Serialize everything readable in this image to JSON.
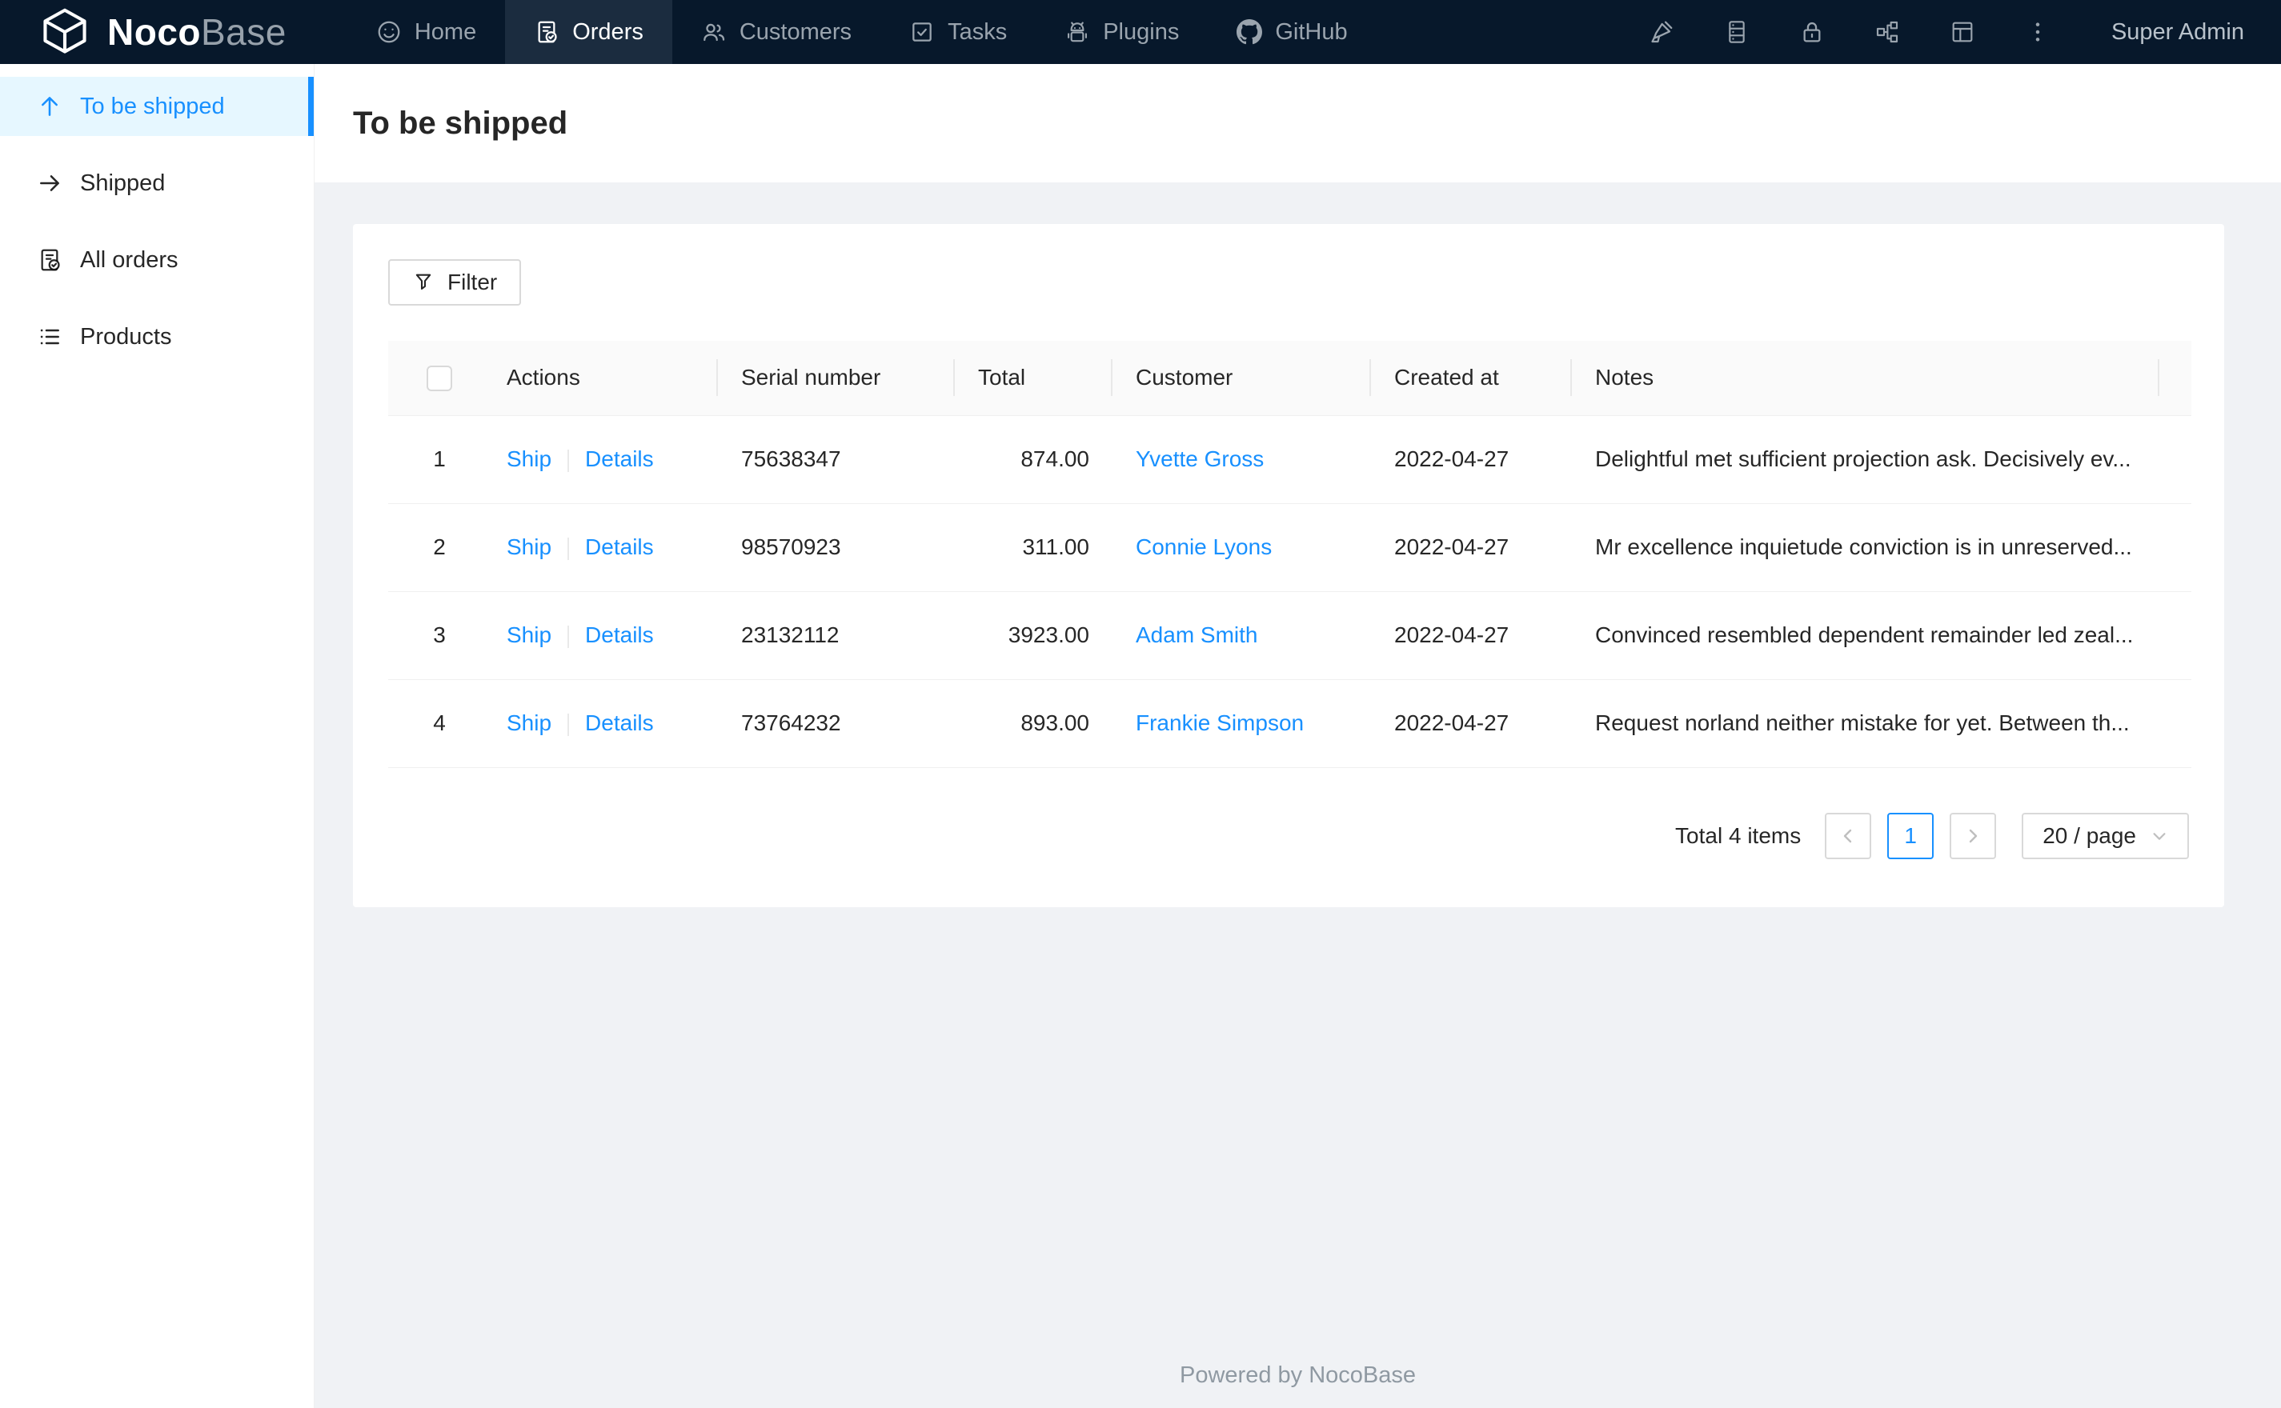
{
  "navbar": {
    "brand_bold": "Noco",
    "brand_light": "Base",
    "items": [
      {
        "label": "Home",
        "icon": "smiley-icon",
        "active": false
      },
      {
        "label": "Orders",
        "icon": "file-done-icon",
        "active": true
      },
      {
        "label": "Customers",
        "icon": "team-icon",
        "active": false
      },
      {
        "label": "Tasks",
        "icon": "check-square-icon",
        "active": false
      },
      {
        "label": "Plugins",
        "icon": "robot-icon",
        "active": false
      },
      {
        "label": "GitHub",
        "icon": "github-icon",
        "active": false
      }
    ],
    "tools": [
      "highlighter-icon",
      "collections-icon",
      "lock-icon",
      "api-icon",
      "layout-icon",
      "ellipsis-icon"
    ],
    "user": "Super Admin"
  },
  "sidebar": {
    "items": [
      {
        "label": "To be shipped",
        "icon": "arrow-up-icon",
        "active": true
      },
      {
        "label": "Shipped",
        "icon": "arrow-right-icon",
        "active": false
      },
      {
        "label": "All orders",
        "icon": "file-done-icon",
        "active": false
      },
      {
        "label": "Products",
        "icon": "list-icon",
        "active": false
      }
    ]
  },
  "page": {
    "title": "To be shipped"
  },
  "toolbar": {
    "filter_label": "Filter"
  },
  "table": {
    "columns": [
      "Actions",
      "Serial number",
      "Total",
      "Customer",
      "Created at",
      "Notes"
    ],
    "action_labels": {
      "ship": "Ship",
      "details": "Details"
    },
    "rows": [
      {
        "index": "1",
        "actions": [
          "Ship",
          "Details"
        ],
        "serial": "75638347",
        "total": "874.00",
        "customer": "Yvette Gross",
        "created_at": "2022-04-27",
        "notes": "Delightful met sufficient projection ask. Decisively ev..."
      },
      {
        "index": "2",
        "actions": [
          "Ship",
          "Details"
        ],
        "serial": "98570923",
        "total": "311.00",
        "customer": "Connie Lyons",
        "created_at": "2022-04-27",
        "notes": "Mr excellence inquietude conviction is in unreserved..."
      },
      {
        "index": "3",
        "actions": [
          "Ship",
          "Details"
        ],
        "serial": "23132112",
        "total": "3923.00",
        "customer": "Adam Smith",
        "created_at": "2022-04-27",
        "notes": "Convinced resembled dependent remainder led zeal..."
      },
      {
        "index": "4",
        "actions": [
          "Ship",
          "Details"
        ],
        "serial": "73764232",
        "total": "893.00",
        "customer": "Frankie Simpson",
        "created_at": "2022-04-27",
        "notes": "Request norland neither mistake for yet. Between th..."
      }
    ]
  },
  "pagination": {
    "total_text": "Total 4 items",
    "current": "1",
    "page_size": "20 / page"
  },
  "footer": {
    "text": "Powered by NocoBase"
  },
  "colors": {
    "accent": "#1890ff",
    "navbar_bg": "#07182b",
    "navbar_active_bg": "#1b2c3f",
    "sidebar_active_bg": "#e6f7ff",
    "page_bg": "#f0f2f5",
    "table_header_bg": "#fafafa"
  }
}
